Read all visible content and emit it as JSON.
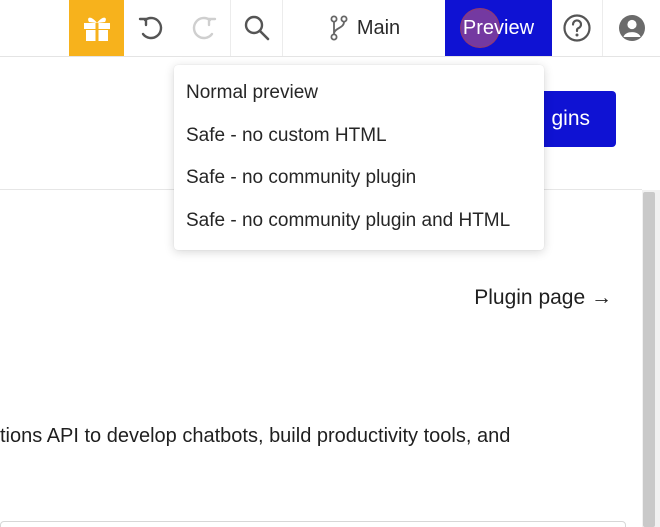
{
  "toolbar": {
    "branch": {
      "icon": "git-branch-icon",
      "label": "Main"
    },
    "preview": {
      "label": "Preview"
    },
    "icons": {
      "gift": "gift-icon",
      "undo": "undo-icon",
      "redo": "redo-icon",
      "search": "search-icon",
      "help": "help-icon",
      "profile": "profile-icon"
    }
  },
  "preview_menu": {
    "items": [
      {
        "label": "Normal preview"
      },
      {
        "label": "Safe - no custom HTML"
      },
      {
        "label": "Safe - no community plugin"
      },
      {
        "label": "Safe - no community plugin and HTML"
      }
    ]
  },
  "main": {
    "plugins_button": "gins",
    "plugin_page_link": "Plugin page →",
    "description": "tions API to develop chatbots, build productivity tools, and"
  },
  "colors": {
    "accent": "#0f12d3",
    "gift_bg": "#f7b21c",
    "cursor_highlight": "#c85a78"
  }
}
